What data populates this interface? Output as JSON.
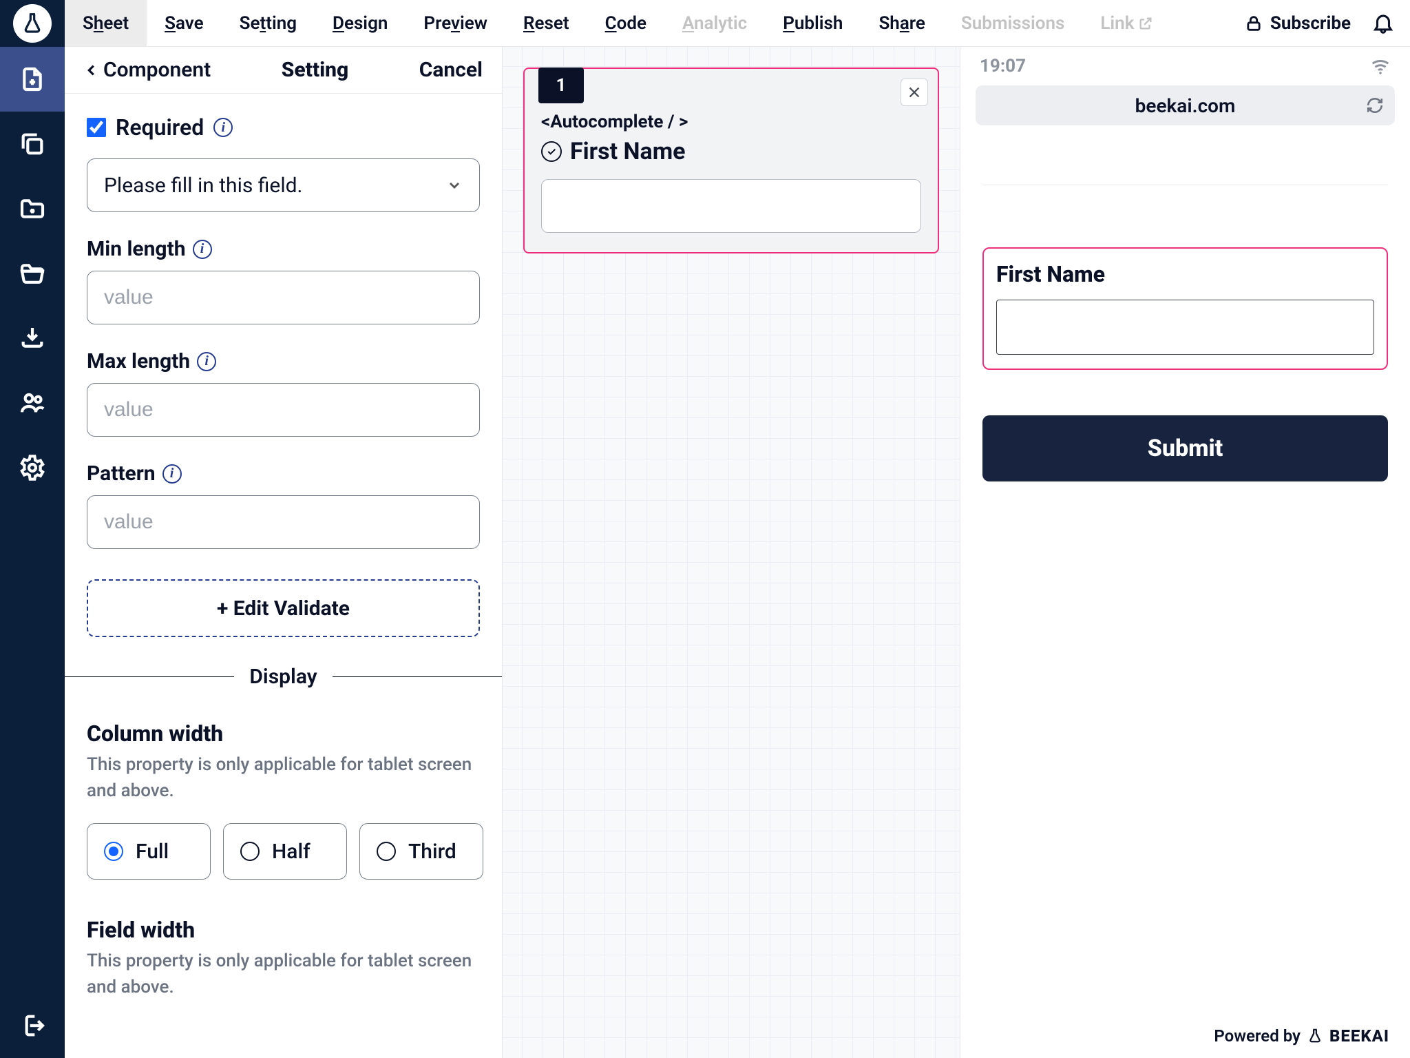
{
  "topnav": {
    "items": [
      {
        "pre": "S",
        "ul": "h",
        "post": "eet",
        "active": true,
        "disabled": false
      },
      {
        "pre": "",
        "ul": "S",
        "post": "ave",
        "active": false,
        "disabled": false
      },
      {
        "pre": "Se",
        "ul": "t",
        "post": "ting",
        "active": false,
        "disabled": false
      },
      {
        "pre": "",
        "ul": "D",
        "post": "esign",
        "active": false,
        "disabled": false
      },
      {
        "pre": "Pre",
        "ul": "v",
        "post": "iew",
        "active": false,
        "disabled": false
      },
      {
        "pre": "",
        "ul": "R",
        "post": "eset",
        "active": false,
        "disabled": false
      },
      {
        "pre": "",
        "ul": "C",
        "post": "ode",
        "active": false,
        "disabled": false
      },
      {
        "pre": "",
        "ul": "A",
        "post": "nalytic",
        "active": false,
        "disabled": true
      },
      {
        "pre": "",
        "ul": "P",
        "post": "ublish",
        "active": false,
        "disabled": false
      },
      {
        "pre": "Sh",
        "ul": "a",
        "post": "re",
        "active": false,
        "disabled": false
      },
      {
        "pre": "Submissions",
        "ul": "",
        "post": "",
        "active": false,
        "disabled": true
      },
      {
        "pre": "Link",
        "ul": "",
        "post": "",
        "active": false,
        "disabled": true,
        "ext": true
      }
    ],
    "subscribe": "Subscribe"
  },
  "settings": {
    "back_label": "Component",
    "title": "Setting",
    "cancel": "Cancel",
    "required_label": "Required",
    "required_checked": true,
    "required_message": "Please fill in this field.",
    "min_label": "Min length",
    "max_label": "Max length",
    "pattern_label": "Pattern",
    "value_placeholder": "value",
    "edit_validate": "+ Edit Validate",
    "display_label": "Display",
    "column_width_title": "Column width",
    "column_width_desc": "This property is only applicable for tablet screen and above.",
    "width_options": [
      "Full",
      "Half",
      "Third"
    ],
    "width_selected": "Full",
    "field_width_title": "Field width",
    "field_width_desc": "This property is only applicable for tablet screen and above."
  },
  "canvas": {
    "badge": "1",
    "tag": "<Autocomplete / >",
    "title": "First Name"
  },
  "preview": {
    "time": "19:07",
    "url": "beekai.com",
    "field_label": "First Name",
    "submit_label": "Submit",
    "powered_by": "Powered by",
    "brand": "BEEKAI"
  },
  "icons": {
    "info": "i"
  },
  "colors": {
    "accent_pink": "#ed2f7d",
    "accent_blue": "#1463ff",
    "nav_bg": "#0b1f3a",
    "submit_bg": "#17233f"
  }
}
